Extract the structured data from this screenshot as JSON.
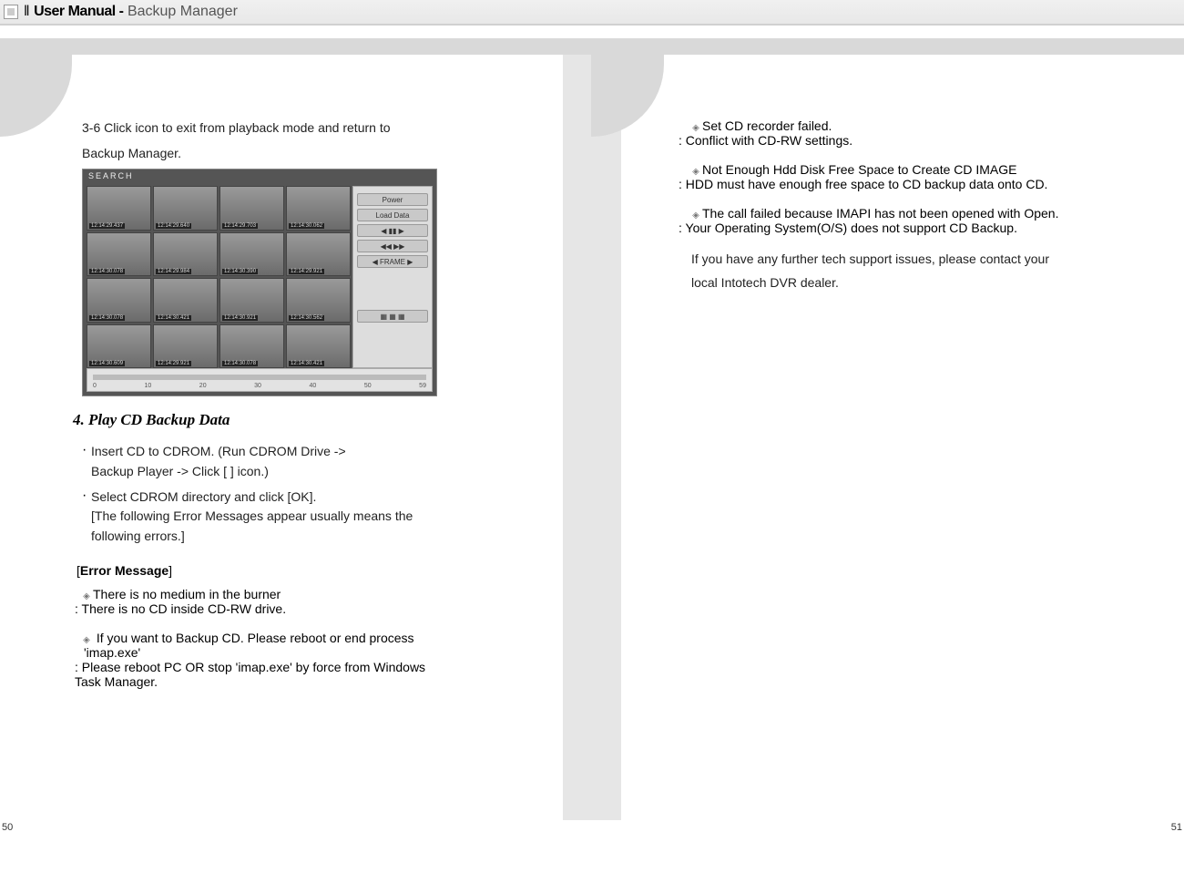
{
  "header": {
    "series_marker": "ǁ",
    "title_strong": "User Manual -",
    "title_light": "Backup Manager"
  },
  "left": {
    "step_3_6_a": "3-6 Click icon to exit from playback mode and return to",
    "step_3_6_b": "Backup Manager.",
    "dvr": {
      "title": "SEARCH",
      "timestamps": [
        "12:14:29.437",
        "12:14:29.640",
        "12:14:29.703",
        "12:14:30.062",
        "12:14:30.078",
        "12:14:29.984",
        "12:14:30.390",
        "12:14:29.921",
        "12:14:30.078",
        "12:14:30.421",
        "12:14:30.921",
        "12:14:30.562",
        "12:14:30.609",
        "12:14:29.921",
        "12:14:30.078",
        "12:14:30.421"
      ],
      "side_buttons": [
        "Power",
        "Load Data"
      ],
      "tick_labels": [
        "0",
        "10",
        "20",
        "30",
        "40",
        "50",
        "59"
      ]
    },
    "section_title": "4.  Play CD Backup Data",
    "bullets": [
      {
        "lines": [
          "Insert CD to CDROM.  (Run CDROM Drive ->",
          "Backup Player -> Click [ ] icon.)"
        ]
      },
      {
        "lines": [
          "Select CDROM directory and click [OK].",
          "[The following Error Messages appear usually means the",
          "following errors.]"
        ]
      }
    ],
    "error_header_open": "[",
    "error_header": "Error Message",
    "error_header_close": "]",
    "errors": [
      {
        "msg": "There is no medium in the burner",
        "expl": ": There is no CD inside CD-RW drive."
      },
      {
        "msg": " If you want to Backup CD. Please reboot or end process",
        "msg2": "'imap.exe'",
        "expl": ": Please reboot PC OR stop  'imap.exe' by force from Windows",
        "expl2": "  Task Manager."
      }
    ],
    "page_no": "50"
  },
  "right": {
    "errors": [
      {
        "msg": "Set CD recorder failed.",
        "expl": ": Conflict with CD-RW settings."
      },
      {
        "msg": "Not Enough Hdd Disk Free Space to Create CD IMAGE",
        "expl": ": HDD must have enough free space to CD backup data onto CD."
      },
      {
        "msg": "The call failed because IMAPI has not been opened with Open.",
        "expl": ": Your Operating System(O/S) does not support CD Backup."
      }
    ],
    "contact_a": "If you have any further tech support issues, please contact your",
    "contact_b": "local Intotech DVR dealer.",
    "page_no": "51"
  }
}
